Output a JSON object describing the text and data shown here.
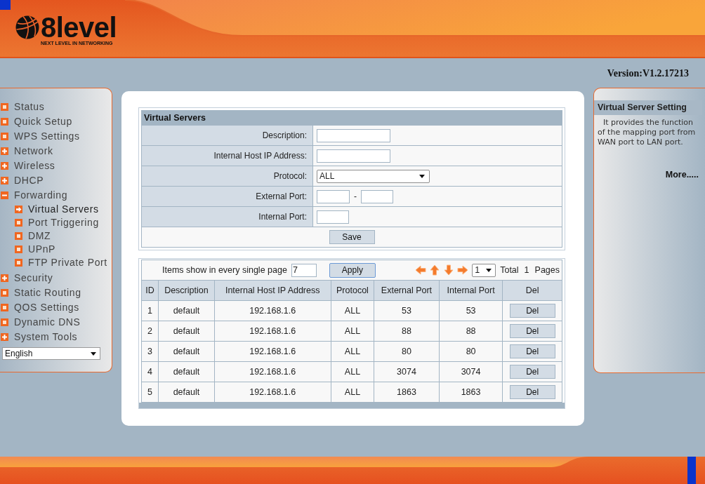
{
  "header": {
    "logo": {
      "wordmark": "8level",
      "tagline": "NEXT LEVEL IN NETWORKING"
    },
    "version": "Version:V1.2.17213"
  },
  "sidebar": {
    "items": [
      {
        "label": "Status",
        "kind": "page",
        "selected": false
      },
      {
        "label": "Quick Setup",
        "kind": "page",
        "selected": false
      },
      {
        "label": "WPS Settings",
        "kind": "page",
        "selected": false
      },
      {
        "label": "Network",
        "kind": "group",
        "expanded": false,
        "selected": false
      },
      {
        "label": "Wireless",
        "kind": "group",
        "expanded": false,
        "selected": false
      },
      {
        "label": "DHCP",
        "kind": "group",
        "expanded": false,
        "selected": false
      },
      {
        "label": "Forwarding",
        "kind": "group",
        "expanded": true,
        "selected": false,
        "children": [
          {
            "label": "Virtual Servers",
            "selected": true
          },
          {
            "label": "Port Triggering",
            "selected": false
          },
          {
            "label": "DMZ",
            "selected": false
          },
          {
            "label": "UPnP",
            "selected": false
          },
          {
            "label": "FTP Private Port",
            "selected": false
          }
        ]
      },
      {
        "label": "Security",
        "kind": "group",
        "expanded": false,
        "selected": false
      },
      {
        "label": "Static Routing",
        "kind": "page",
        "selected": false
      },
      {
        "label": "QOS Settings",
        "kind": "page",
        "selected": false
      },
      {
        "label": "Dynamic DNS",
        "kind": "page",
        "selected": false
      },
      {
        "label": "System Tools",
        "kind": "group",
        "expanded": false,
        "selected": false
      }
    ],
    "language": "English"
  },
  "form": {
    "title": "Virtual Servers",
    "fields": [
      {
        "kind": "text",
        "label": "Description:"
      },
      {
        "kind": "text",
        "label": "Internal Host IP Address:"
      },
      {
        "kind": "select",
        "label": "Protocol:",
        "value": "ALL"
      },
      {
        "kind": "port_range",
        "label": "External Port:",
        "separator": "-"
      },
      {
        "kind": "port",
        "label": "Internal Port:"
      }
    ],
    "save_button": "Save"
  },
  "list": {
    "page_size_label": "Items show in every single page",
    "page_size": "7",
    "apply_button": "Apply",
    "page": "1",
    "total_label": "Total",
    "total_pages": "1",
    "pages_label": "Pages",
    "columns": [
      "ID",
      "Description",
      "Internal Host IP Address",
      "Protocol",
      "External Port",
      "Internal Port",
      "Del"
    ],
    "rows": [
      {
        "cells": [
          "1",
          "default",
          "192.168.1.6",
          "ALL",
          "53",
          "53"
        ],
        "delete_button": "Del"
      },
      {
        "cells": [
          "2",
          "default",
          "192.168.1.6",
          "ALL",
          "88",
          "88"
        ],
        "delete_button": "Del"
      },
      {
        "cells": [
          "3",
          "default",
          "192.168.1.6",
          "ALL",
          "80",
          "80"
        ],
        "delete_button": "Del"
      },
      {
        "cells": [
          "4",
          "default",
          "192.168.1.6",
          "ALL",
          "3074",
          "3074"
        ],
        "delete_button": "Del"
      },
      {
        "cells": [
          "5",
          "default",
          "192.168.1.6",
          "ALL",
          "1863",
          "1863"
        ],
        "delete_button": "Del"
      }
    ]
  },
  "help": {
    "title": "Virtual Server Setting",
    "text": "It provides the function of the mapping port from WAN port to LAN port.",
    "more_link": "More....."
  }
}
